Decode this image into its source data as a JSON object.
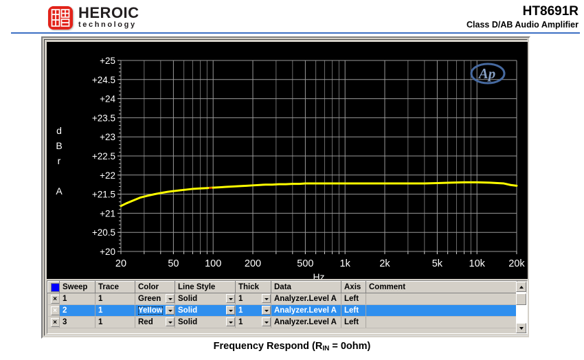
{
  "header": {
    "brand_main": "HEROIC",
    "brand_sub": "technology",
    "logo_icon": "heroic-seal-logo",
    "part_number": "HT8691R",
    "part_desc": "Class D/AB Audio Amplifier",
    "rule_color": "#3b6fc4"
  },
  "caption": {
    "text_before": "Frequency Respond (R",
    "subscript": "IN",
    "text_after": " = 0ohm)"
  },
  "chart_data": {
    "type": "line",
    "title": "",
    "xlabel": "Hz",
    "ylabel": "dBrA",
    "ylabel_chars": [
      "d",
      "B",
      "r",
      "",
      "A"
    ],
    "watermark": "Ap",
    "background": "#000000",
    "grid": true,
    "grid_color": "#808080",
    "xscale": "log",
    "xlim": [
      20,
      20000
    ],
    "ylim": [
      20,
      25
    ],
    "xticks": [
      20,
      50,
      100,
      200,
      500,
      1000,
      2000,
      5000,
      10000,
      20000
    ],
    "xtick_labels": [
      "20",
      "50",
      "100",
      "200",
      "500",
      "1k",
      "2k",
      "5k",
      "10k",
      "20k"
    ],
    "yticks": [
      20,
      20.5,
      21,
      21.5,
      22,
      22.5,
      23,
      23.5,
      24,
      24.5,
      25
    ],
    "ytick_labels": [
      "+20",
      "+20.5",
      "+21",
      "+21.5",
      "+22",
      "+22.5",
      "+23",
      "+23.5",
      "+24",
      "+24.5",
      "+25"
    ],
    "series": [
      {
        "name": "Analyzer.Level A",
        "color": "#ffff00",
        "x": [
          20,
          22,
          25,
          28,
          32,
          36,
          40,
          45,
          50,
          56,
          63,
          71,
          80,
          90,
          100,
          112,
          125,
          140,
          160,
          180,
          200,
          225,
          250,
          280,
          315,
          355,
          400,
          450,
          500,
          560,
          630,
          710,
          800,
          900,
          1000,
          1250,
          1600,
          2000,
          2500,
          3150,
          4000,
          5000,
          6300,
          8000,
          10000,
          12500,
          16000,
          18000,
          20000
        ],
        "y": [
          21.19,
          21.26,
          21.34,
          21.41,
          21.46,
          21.5,
          21.53,
          21.56,
          21.58,
          21.6,
          21.62,
          21.64,
          21.65,
          21.66,
          21.67,
          21.68,
          21.69,
          21.7,
          21.71,
          21.72,
          21.73,
          21.74,
          21.75,
          21.75,
          21.76,
          21.76,
          21.77,
          21.77,
          21.78,
          21.78,
          21.78,
          21.78,
          21.78,
          21.78,
          21.78,
          21.78,
          21.78,
          21.78,
          21.78,
          21.78,
          21.78,
          21.79,
          21.8,
          21.81,
          21.81,
          21.8,
          21.78,
          21.74,
          21.72
        ]
      }
    ]
  },
  "table": {
    "headers": [
      "",
      "Sweep",
      "Trace",
      "Color",
      "Line Style",
      "Thick",
      "Data",
      "Axis",
      "Comment",
      ""
    ],
    "header_swatch_color": "#0000ff",
    "close_label": "×",
    "rows": [
      {
        "sweep": "1",
        "trace": "1",
        "color": "Green",
        "line_style": "Solid",
        "thick": "1",
        "data": "Analyzer.Level A",
        "axis": "Left",
        "comment": "",
        "selected": false,
        "focused": false
      },
      {
        "sweep": "2",
        "trace": "1",
        "color": "Yellow",
        "line_style": "Solid",
        "thick": "1",
        "data": "Analyzer.Level A",
        "axis": "Left",
        "comment": "",
        "selected": true,
        "focused": true
      },
      {
        "sweep": "3",
        "trace": "1",
        "color": "Red",
        "line_style": "Solid",
        "thick": "1",
        "data": "Analyzer.Level A",
        "axis": "Left",
        "comment": "",
        "selected": false,
        "focused": false
      }
    ]
  }
}
